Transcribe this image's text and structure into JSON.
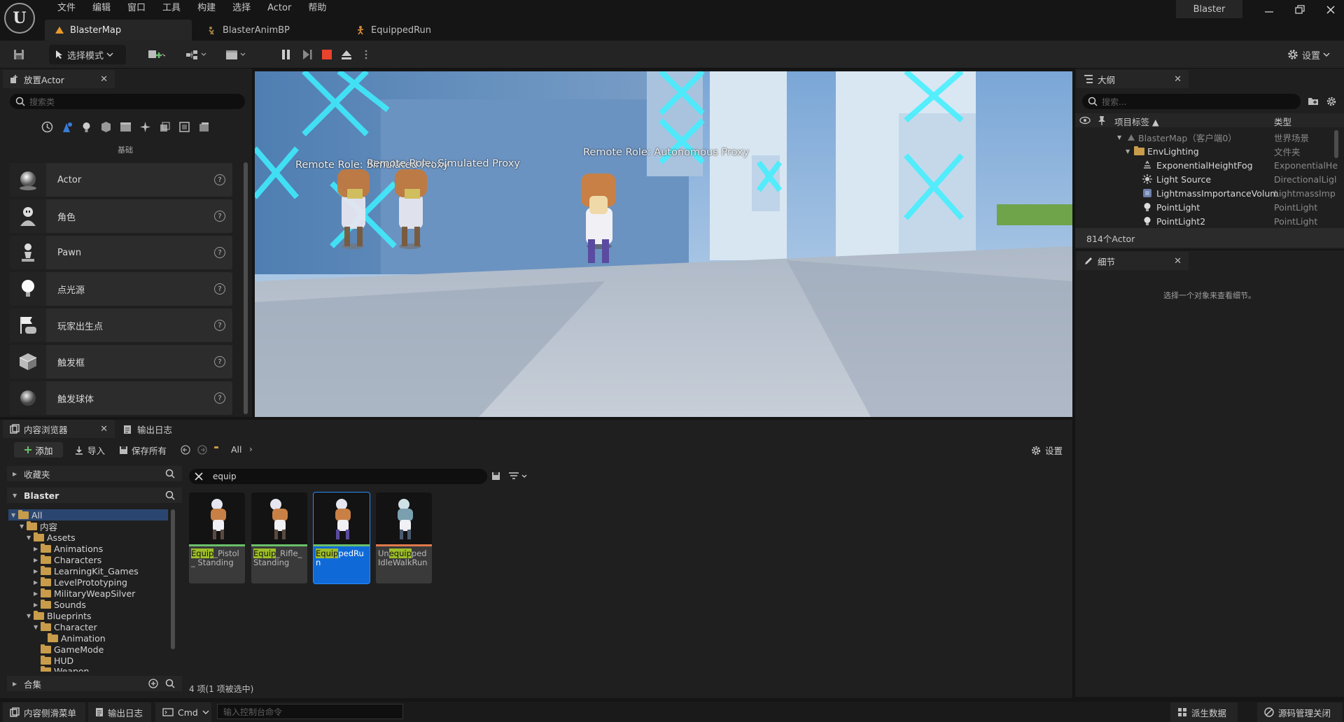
{
  "app": {
    "project": "Blaster",
    "logo": "U"
  },
  "menu": [
    "文件",
    "编辑",
    "窗口",
    "工具",
    "构建",
    "选择",
    "Actor",
    "帮助"
  ],
  "doc_tabs": [
    {
      "label": "BlasterMap",
      "icon": "level-icon"
    },
    {
      "label": "BlasterAnimBP",
      "icon": "anim-blueprint-icon"
    },
    {
      "label": "EquippedRun",
      "icon": "anim-sequence-icon"
    }
  ],
  "toolbar": {
    "mode_label": "选择模式",
    "settings_label": "设置"
  },
  "place_actors": {
    "title": "放置Actor",
    "search_placeholder": "搜索类",
    "category": "基础",
    "items": [
      {
        "label": "Actor",
        "icon": "sphere-icon"
      },
      {
        "label": "角色",
        "icon": "character-icon"
      },
      {
        "label": "Pawn",
        "icon": "pawn-icon"
      },
      {
        "label": "点光源",
        "icon": "point-light-icon"
      },
      {
        "label": "玩家出生点",
        "icon": "player-start-icon"
      },
      {
        "label": "触发框",
        "icon": "trigger-box-icon"
      },
      {
        "label": "触发球体",
        "icon": "trigger-sphere-icon"
      }
    ]
  },
  "viewport": {
    "labels": [
      "Remote Role: Simulated Proxy",
      "Remote Role: Simulated Proxy",
      "Remote Role: Autonomous Proxy"
    ]
  },
  "outliner": {
    "title": "大纲",
    "search_placeholder": "搜索...",
    "col_label": "项目标签 ▲",
    "col_type": "类型",
    "rows": [
      {
        "label": "BlasterMap（客户端0）",
        "type": "世界场景"
      },
      {
        "label": "EnvLighting",
        "type": "文件夹"
      },
      {
        "label": "ExponentialHeightFog",
        "type": "ExponentialHe"
      },
      {
        "label": "Light Source",
        "type": "DirectionalLigl"
      },
      {
        "label": "LightmassImportanceVolum",
        "type": "LightmassImp"
      },
      {
        "label": "PointLight",
        "type": "PointLight"
      },
      {
        "label": "PointLight2",
        "type": "PointLight"
      }
    ],
    "count": "814个Actor"
  },
  "details": {
    "title": "细节",
    "empty": "选择一个对象来查看细节。"
  },
  "content_browser": {
    "tab": "内容浏览器",
    "log_tab": "输出日志",
    "add": "添加",
    "import": "导入",
    "save_all": "保存所有",
    "path": "All",
    "settings": "设置",
    "favorites": "收藏夹",
    "project": "Blaster",
    "collections": "合集",
    "search_value": "equip",
    "tree": [
      "All",
      "内容",
      "Assets",
      "Animations",
      "Characters",
      "LearningKit_Games",
      "LevelPrototyping",
      "MilitaryWeapSilver",
      "Sounds",
      "Blueprints",
      "Character",
      "Animation",
      "GameMode",
      "HUD",
      "Weapon"
    ],
    "assets": [
      {
        "pre": "",
        "hl": "Equip",
        "post": "_Pistol_ Standing"
      },
      {
        "pre": "",
        "hl": "Equip",
        "post": "_Rifle_ Standing"
      },
      {
        "pre": "",
        "hl": "Equip",
        "post": "pedRun"
      },
      {
        "pre": "Un",
        "hl": "equip",
        "post": "ped IdleWalkRun"
      }
    ],
    "status": "4 项(1 项被选中)"
  },
  "statusbar": {
    "drawer": "内容侧滑菜单",
    "log": "输出日志",
    "cmd": "Cmd",
    "cmd_placeholder": "输入控制台命令",
    "derived": "派生数据",
    "source": "源码管理关闭"
  }
}
